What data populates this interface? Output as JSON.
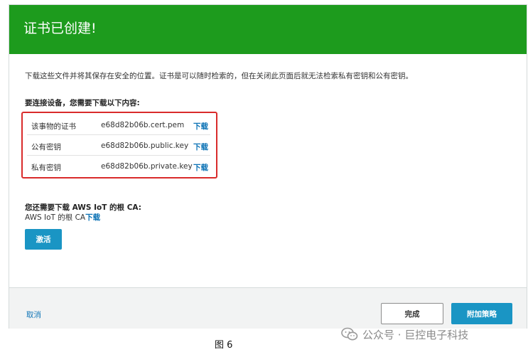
{
  "header": {
    "title": "证书已创建!",
    "color": "#1d9b1d"
  },
  "intro_text": "下载这些文件并将其保存在安全的位置。证书是可以随时检索的，但在关闭此页面后就无法检索私有密钥和公有密钥。",
  "required_heading": "要连接设备，您需要下载以下内容:",
  "files": [
    {
      "label": "该事物的证书",
      "filename": "e68d82b06b.cert.pem",
      "action": "下载"
    },
    {
      "label": "公有密钥",
      "filename": "e68d82b06b.public.key",
      "action": "下载"
    },
    {
      "label": "私有密钥",
      "filename": "e68d82b06b.private.key",
      "action": "下载"
    }
  ],
  "root_ca": {
    "heading": "您还需要下载 AWS IoT 的根 CA:",
    "text": "AWS IoT 的根 CA",
    "action": "下载"
  },
  "activate_label": "激活",
  "footer": {
    "cancel_label": "取消",
    "done_label": "完成",
    "attach_label": "附加策略"
  },
  "caption": "图 6",
  "watermark": {
    "text": "公众号 · 巨控电子科技",
    "icon": "wechat-icon"
  },
  "colors": {
    "accent": "#1a95c4",
    "link": "#0b72b5",
    "highlight": "#d92b2b"
  }
}
